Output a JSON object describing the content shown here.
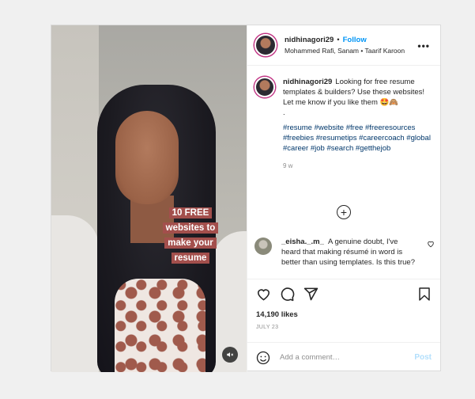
{
  "post": {
    "username": "nidhinagori29",
    "follow_label": "Follow",
    "header_dot": "•",
    "audio": "Mohammed Rafi, Sanam • Taarif Karoon",
    "overlay_text": "10 FREE websites to make your resume",
    "caption": {
      "text": "Looking for free resume templates & builders? Use these websites!",
      "line2": "Let me know if you like them 🤩🙈",
      "line3": ".",
      "hashtags": "#resume #website #free #freeresources #freebies #resumetips #careercoach #global #career #job #search #getthejob",
      "time_ago": "9 w"
    },
    "load_more_icon": "plus-circle-icon",
    "comment": {
      "username": "_eisha._.m_",
      "text": "A genuine doubt, I've heard that making résumé in word is better than using templates. Is this true?"
    },
    "likes": "14,190 likes",
    "date": "JULY 23",
    "add_comment": {
      "placeholder": "Add a comment…",
      "post_label": "Post"
    },
    "colors": {
      "accent": "#0095f6",
      "overlay_bg": "#a34f4c",
      "hashtag": "#00376b",
      "post_disabled": "#b2dffc"
    }
  }
}
